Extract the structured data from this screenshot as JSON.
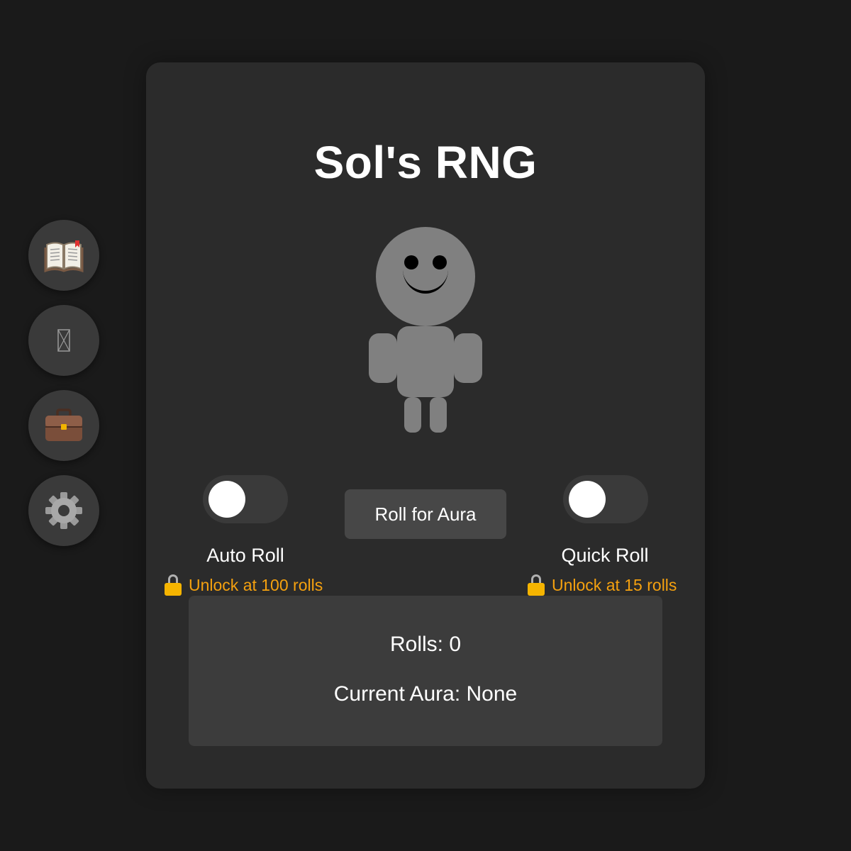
{
  "sidebar": {
    "items": [
      {
        "icon": "book-icon"
      },
      {
        "icon": "missing-glyph-icon"
      },
      {
        "icon": "briefcase-icon"
      },
      {
        "icon": "gear-icon"
      }
    ]
  },
  "game": {
    "title": "Sol's RNG",
    "roll_button": "Roll for Aura",
    "auto_roll": {
      "label": "Auto Roll",
      "unlock_text": "Unlock at 100 rolls",
      "enabled": false
    },
    "quick_roll": {
      "label": "Quick Roll",
      "unlock_text": "Unlock at 15 rolls",
      "enabled": false
    },
    "stats": {
      "rolls_text": "Rolls: 0",
      "aura_text": "Current Aura: None"
    }
  },
  "colors": {
    "background": "#1a1a1a",
    "card": "#2b2b2b",
    "accent_unlock": "#f5a10f",
    "avatar": "#808080"
  }
}
